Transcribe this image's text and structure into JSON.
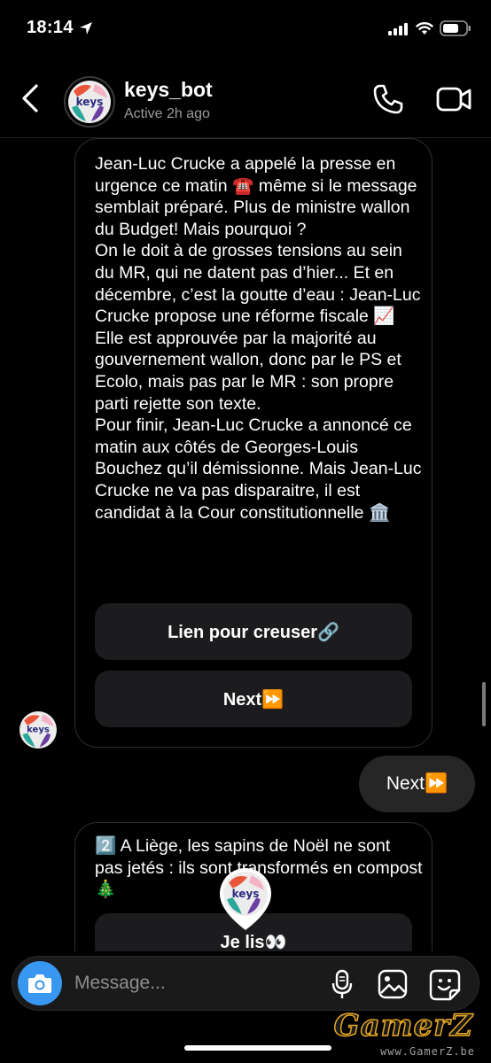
{
  "status_bar": {
    "time": "18:14"
  },
  "header": {
    "name": "keys_bot",
    "status": "Active 2h ago",
    "avatar_text": "keys"
  },
  "messages": {
    "bot_message_1": {
      "text": "Jean-Luc Crucke a appelé la presse en urgence ce matin ☎️ même si le message semblait préparé. Plus de ministre wallon du Budget! Mais pourquoi ?\nOn le doit à de grosses tensions au sein du MR, qui ne datent pas d’hier... Et en décembre, c’est la goutte d’eau : Jean-Luc Crucke propose une réforme fiscale 📈 Elle est approuvée par la majorité au gouvernement wallon, donc par le PS et Ecolo, mais pas par le MR : son propre parti rejette son texte.\nPour finir, Jean-Luc Crucke a annoncé ce matin aux côtés de Georges-Louis Bouchez qu’il démissionne. Mais Jean-Luc Crucke ne va pas disparaitre, il est candidat à la Cour constitutionnelle 🏛️",
      "buttons": [
        "Lien pour creuser🔗",
        "Next⏩"
      ]
    },
    "user_reply": {
      "text": "Next⏩"
    },
    "bot_message_2": {
      "text": "2️⃣ A Liège, les sapins de Noël ne sont pas jetés : ils sont transformés en compost 🎄",
      "buttons": [
        "Je lis👀"
      ]
    }
  },
  "composer": {
    "placeholder": "Message..."
  },
  "watermark": {
    "title": "GamerZ",
    "url": "www.GamerZ.be"
  },
  "colors": {
    "background": "#000000",
    "bubble_border": "#2e2e2e",
    "quick_reply_bg": "#1c1c1e",
    "outgoing_bubble": "#262626",
    "camera_blue": "#3897f0"
  }
}
